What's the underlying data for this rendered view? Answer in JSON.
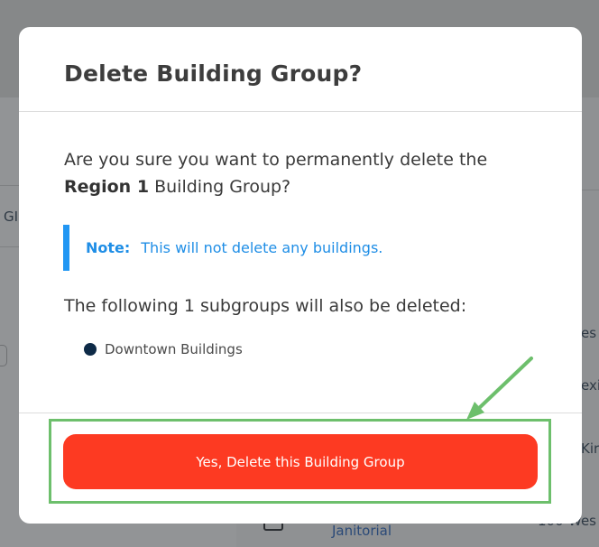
{
  "background": {
    "left_text_fragment": "GI",
    "right_text_fragments": [
      "es",
      "exi",
      "Kir",
      "Wes"
    ],
    "bottom_link": "Janitorial",
    "bottom_number": "100"
  },
  "modal": {
    "title": "Delete Building Group?",
    "confirm_prefix": "Are you sure you want to permanently delete the",
    "group_name": "Region 1",
    "confirm_suffix": "Building Group?",
    "note": {
      "label": "Note:",
      "text": "This will not delete any buildings."
    },
    "subgroups_heading_prefix": "The following",
    "subgroups_count": "1",
    "subgroups_heading_suffix": "subgroups will also be deleted:",
    "subgroups": [
      {
        "label": "Downtown Buildings"
      }
    ],
    "delete_button_label": "Yes, Delete this Building Group"
  },
  "colors": {
    "accent_danger": "#fd3a22",
    "note_blue": "#2196f3",
    "annotation_green": "#6dbf6c",
    "bullet_navy": "#0e2a47"
  }
}
